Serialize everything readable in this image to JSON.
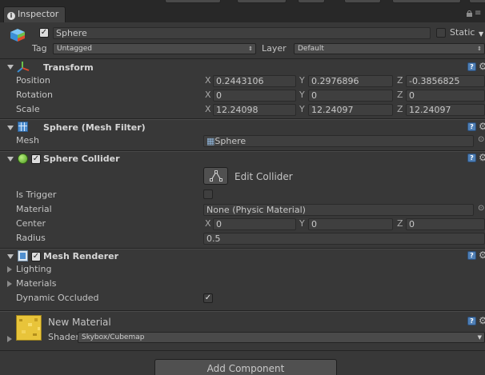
{
  "window": {
    "tab_label": "Inspector",
    "tab_icon": "info-icon"
  },
  "object": {
    "name": "Sphere",
    "active": true,
    "static_label": "Static",
    "tag_label": "Tag",
    "tag_value": "Untagged",
    "layer_label": "Layer",
    "layer_value": "Default"
  },
  "transform": {
    "title": "Transform",
    "position_label": "Position",
    "rotation_label": "Rotation",
    "scale_label": "Scale",
    "axis_x": "X",
    "axis_y": "Y",
    "axis_z": "Z",
    "position": {
      "x": "0.2443106",
      "y": "0.2976896",
      "z": "-0.3856825"
    },
    "rotation": {
      "x": "0",
      "y": "0",
      "z": "0"
    },
    "scale": {
      "x": "12.24098",
      "y": "12.24097",
      "z": "12.24097"
    }
  },
  "mesh_filter": {
    "title": "Sphere (Mesh Filter)",
    "mesh_label": "Mesh",
    "mesh_value": "Sphere"
  },
  "sphere_collider": {
    "title": "Sphere Collider",
    "enabled": true,
    "edit_collider_label": "Edit Collider",
    "is_trigger_label": "Is Trigger",
    "is_trigger": false,
    "material_label": "Material",
    "material_value": "None (Physic Material)",
    "center_label": "Center",
    "center": {
      "x": "0",
      "y": "0",
      "z": "0"
    },
    "radius_label": "Radius",
    "radius_value": "0.5"
  },
  "mesh_renderer": {
    "title": "Mesh Renderer",
    "enabled": true,
    "lighting_label": "Lighting",
    "materials_label": "Materials",
    "dynamic_occluded_label": "Dynamic Occluded",
    "dynamic_occluded": true
  },
  "material": {
    "name": "New Material",
    "shader_label": "Shader",
    "shader_value": "Skybox/Cubemap"
  },
  "add_component_label": "Add Component",
  "colors": {
    "background": "#383838",
    "accent_blue": "#4f7fb5",
    "material_preview": "#e8c43a"
  }
}
